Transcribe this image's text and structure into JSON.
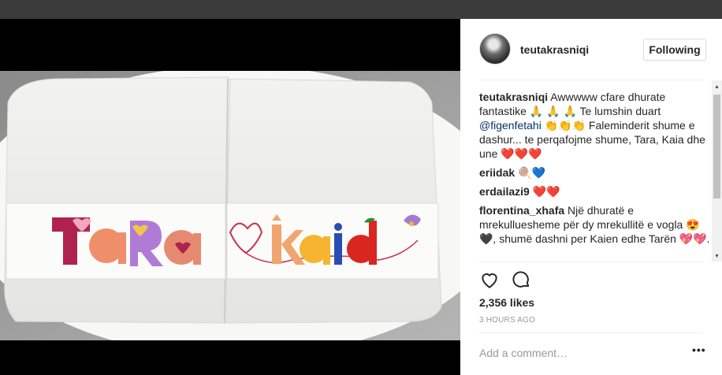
{
  "post": {
    "username": "teutakrasniqi",
    "follow_label": "Following",
    "likes": "2,356 likes",
    "time_ago": "3 HOURS AGO",
    "comment_placeholder": "Add a comment…",
    "more_label": "•••"
  },
  "caption": {
    "user": "teutakrasniqi",
    "text_1": " Awwwww cfare dhurate fantastike 🙏 🙏 🙏 Te lumshin duart ",
    "mention": "@figenfetahi",
    "text_2": " 👏👏👏 Faleminderit shume e dashur... te perqafojme shume, Tara, Kaia dhe une ❤️❤️❤️"
  },
  "comments": [
    {
      "user": "eriidak",
      "text": " 🍭💙"
    },
    {
      "user": "erdailazi9",
      "text": " ❤️❤️"
    },
    {
      "user": "florentina_xhafa",
      "text": " Një dhuratë e mrekulluesheme për dy mrekullitë e vogla 😍🖤, shumë dashni per Kaien edhe Tarën 💖💖."
    }
  ],
  "photo": {
    "name_left": "TaRa",
    "name_right": "kaia"
  },
  "icons": {
    "heart": "heart-icon",
    "comment": "comment-icon",
    "more": "more-options-icon"
  },
  "colors": {
    "text": "#262626",
    "mention": "#003569",
    "muted": "#999999",
    "border": "#efefef"
  }
}
